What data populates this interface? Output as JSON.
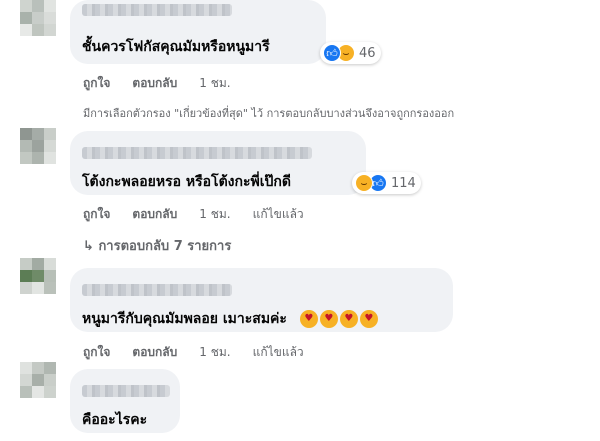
{
  "comments": [
    {
      "text": "ชั้นควรโฟกัสคุณมัมหรือหนูมารี",
      "reaction_count": "46",
      "reaction_icons": [
        "like-icon",
        "haha-icon"
      ],
      "actions": {
        "like": "ถูกใจ",
        "reply": "ตอบกลับ",
        "time": "1 ชม.",
        "edited": ""
      }
    },
    {
      "text": "โต้งกะพลอยหรอ หรือโต้งกะพี่เป๊กดี",
      "reaction_count": "114",
      "reaction_icons": [
        "haha-icon",
        "like-icon"
      ],
      "actions": {
        "like": "ถูกใจ",
        "reply": "ตอบกลับ",
        "time": "1 ชม.",
        "edited": "แก้ไขแล้ว"
      }
    },
    {
      "text": "หนูมารีกับคุณมัมพลอย เมาะสมค่ะ",
      "emojis": [
        "heart-eyes-emoji",
        "heart-eyes-emoji",
        "smiling-hearts-emoji",
        "smiling-hearts-emoji"
      ],
      "actions": {
        "like": "ถูกใจ",
        "reply": "ตอบกลับ",
        "time": "1 ชม.",
        "edited": "แก้ไขแล้ว"
      }
    },
    {
      "text": "คืออะไรคะ"
    }
  ],
  "filter_note": "มีการเลือกตัวกรอง \"เกี่ยวข้องที่สุด\" ไว้ การตอบกลับบางส่วนจึงอาจถูกกรองออก",
  "view_replies": "การตอบกลับ 7 รายการ",
  "colors": {
    "bubble": "#f0f2f5",
    "meta_text": "#65676b",
    "like_blue": "#1877f2",
    "haha_yellow": "#f7b125"
  }
}
